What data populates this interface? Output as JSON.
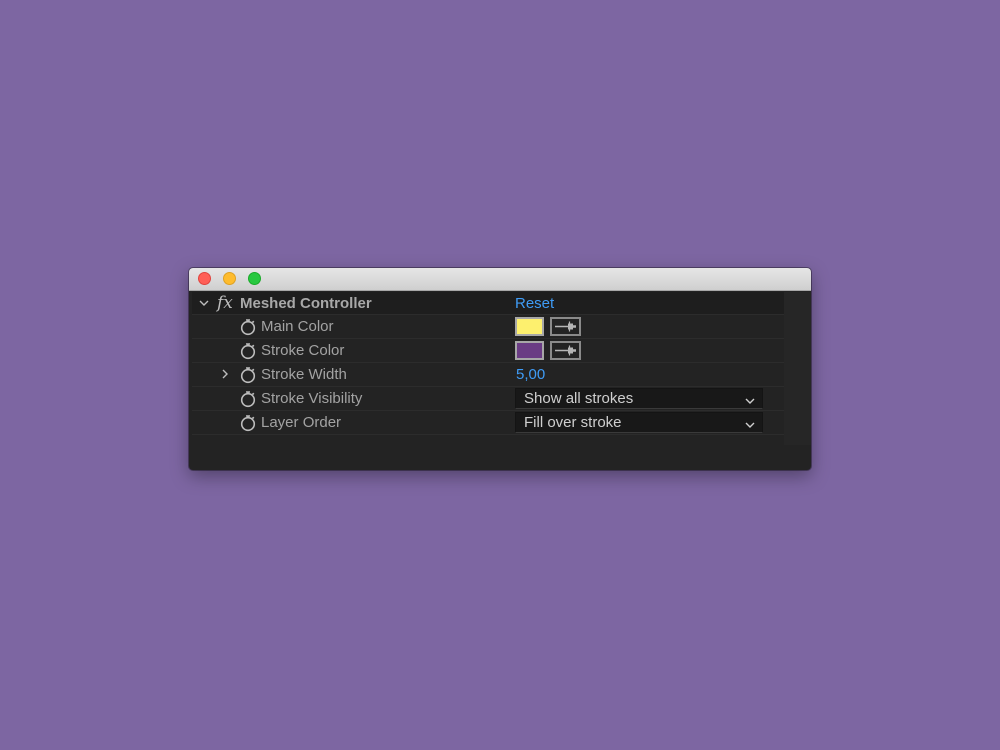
{
  "window": {
    "controls": [
      "close",
      "minimize",
      "zoom"
    ]
  },
  "effect": {
    "icon": "fx-icon",
    "name": "Meshed Controller",
    "reset_label": "Reset",
    "properties": [
      {
        "label": "Main Color",
        "type": "color",
        "color": "#fdf06e"
      },
      {
        "label": "Stroke Color",
        "type": "color",
        "color": "#6a3c84"
      },
      {
        "label": "Stroke Width",
        "type": "number",
        "value": "5,00"
      },
      {
        "label": "Stroke Visibility",
        "type": "dropdown",
        "selected": "Show all strokes"
      },
      {
        "label": "Layer Order",
        "type": "dropdown",
        "selected": "Fill over stroke"
      }
    ]
  },
  "colors": {
    "background": "#7d66a2",
    "panel": "#232323",
    "accent": "#3f9cf6"
  }
}
